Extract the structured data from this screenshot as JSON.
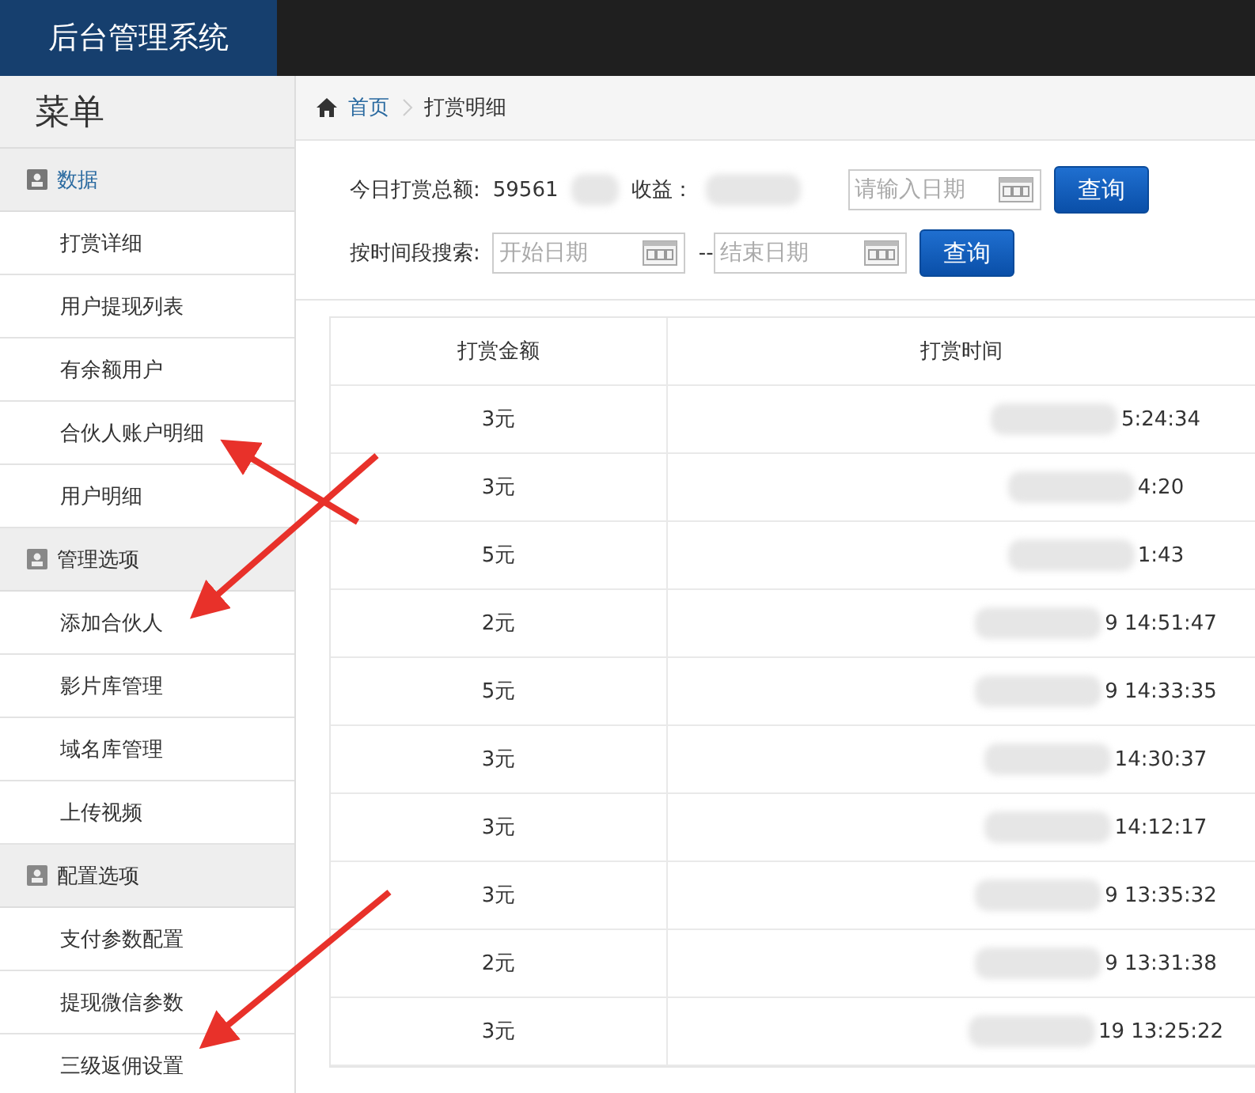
{
  "header": {
    "title": "后台管理系统"
  },
  "sidebar": {
    "title": "菜单",
    "sections": [
      {
        "label": "数据",
        "selected": true,
        "items": [
          {
            "label": "打赏详细"
          },
          {
            "label": "用户提现列表"
          },
          {
            "label": "有余额用户"
          },
          {
            "label": "合伙人账户明细"
          },
          {
            "label": "用户明细"
          }
        ]
      },
      {
        "label": "管理选项",
        "selected": false,
        "items": [
          {
            "label": "添加合伙人"
          },
          {
            "label": "影片库管理"
          },
          {
            "label": "域名库管理"
          },
          {
            "label": "上传视频"
          }
        ]
      },
      {
        "label": "配置选项",
        "selected": false,
        "items": [
          {
            "label": "支付参数配置"
          },
          {
            "label": "提现微信参数"
          },
          {
            "label": "三级返佣设置"
          }
        ]
      }
    ]
  },
  "breadcrumb": [
    {
      "label": "首页",
      "kind": "link"
    },
    {
      "label": "打赏明细",
      "kind": "current"
    }
  ],
  "summary": {
    "label": "今日打赏总额:",
    "value": "59561",
    "income_label": "收益：",
    "date": {
      "placeholder": "请输入日期"
    },
    "button": "查询"
  },
  "range": {
    "label": "按时间段搜索:",
    "start": {
      "placeholder": "开始日期"
    },
    "separator": "--",
    "end": {
      "placeholder": "结束日期"
    },
    "button": "查询"
  },
  "table": {
    "columns": [
      "打赏金额",
      "打赏时间"
    ],
    "rows": [
      [
        "3元",
        "5:24:34"
      ],
      [
        "3元",
        "4:20"
      ],
      [
        "5元",
        "1:43"
      ],
      [
        "2元",
        "9 14:51:47"
      ],
      [
        "5元",
        "9 14:33:35"
      ],
      [
        "3元",
        "14:30:37"
      ],
      [
        "3元",
        "14:12:17"
      ],
      [
        "3元",
        "9 13:35:32"
      ],
      [
        "2元",
        "9 13:31:38"
      ],
      [
        "3元",
        "19 13:25:22"
      ]
    ]
  }
}
